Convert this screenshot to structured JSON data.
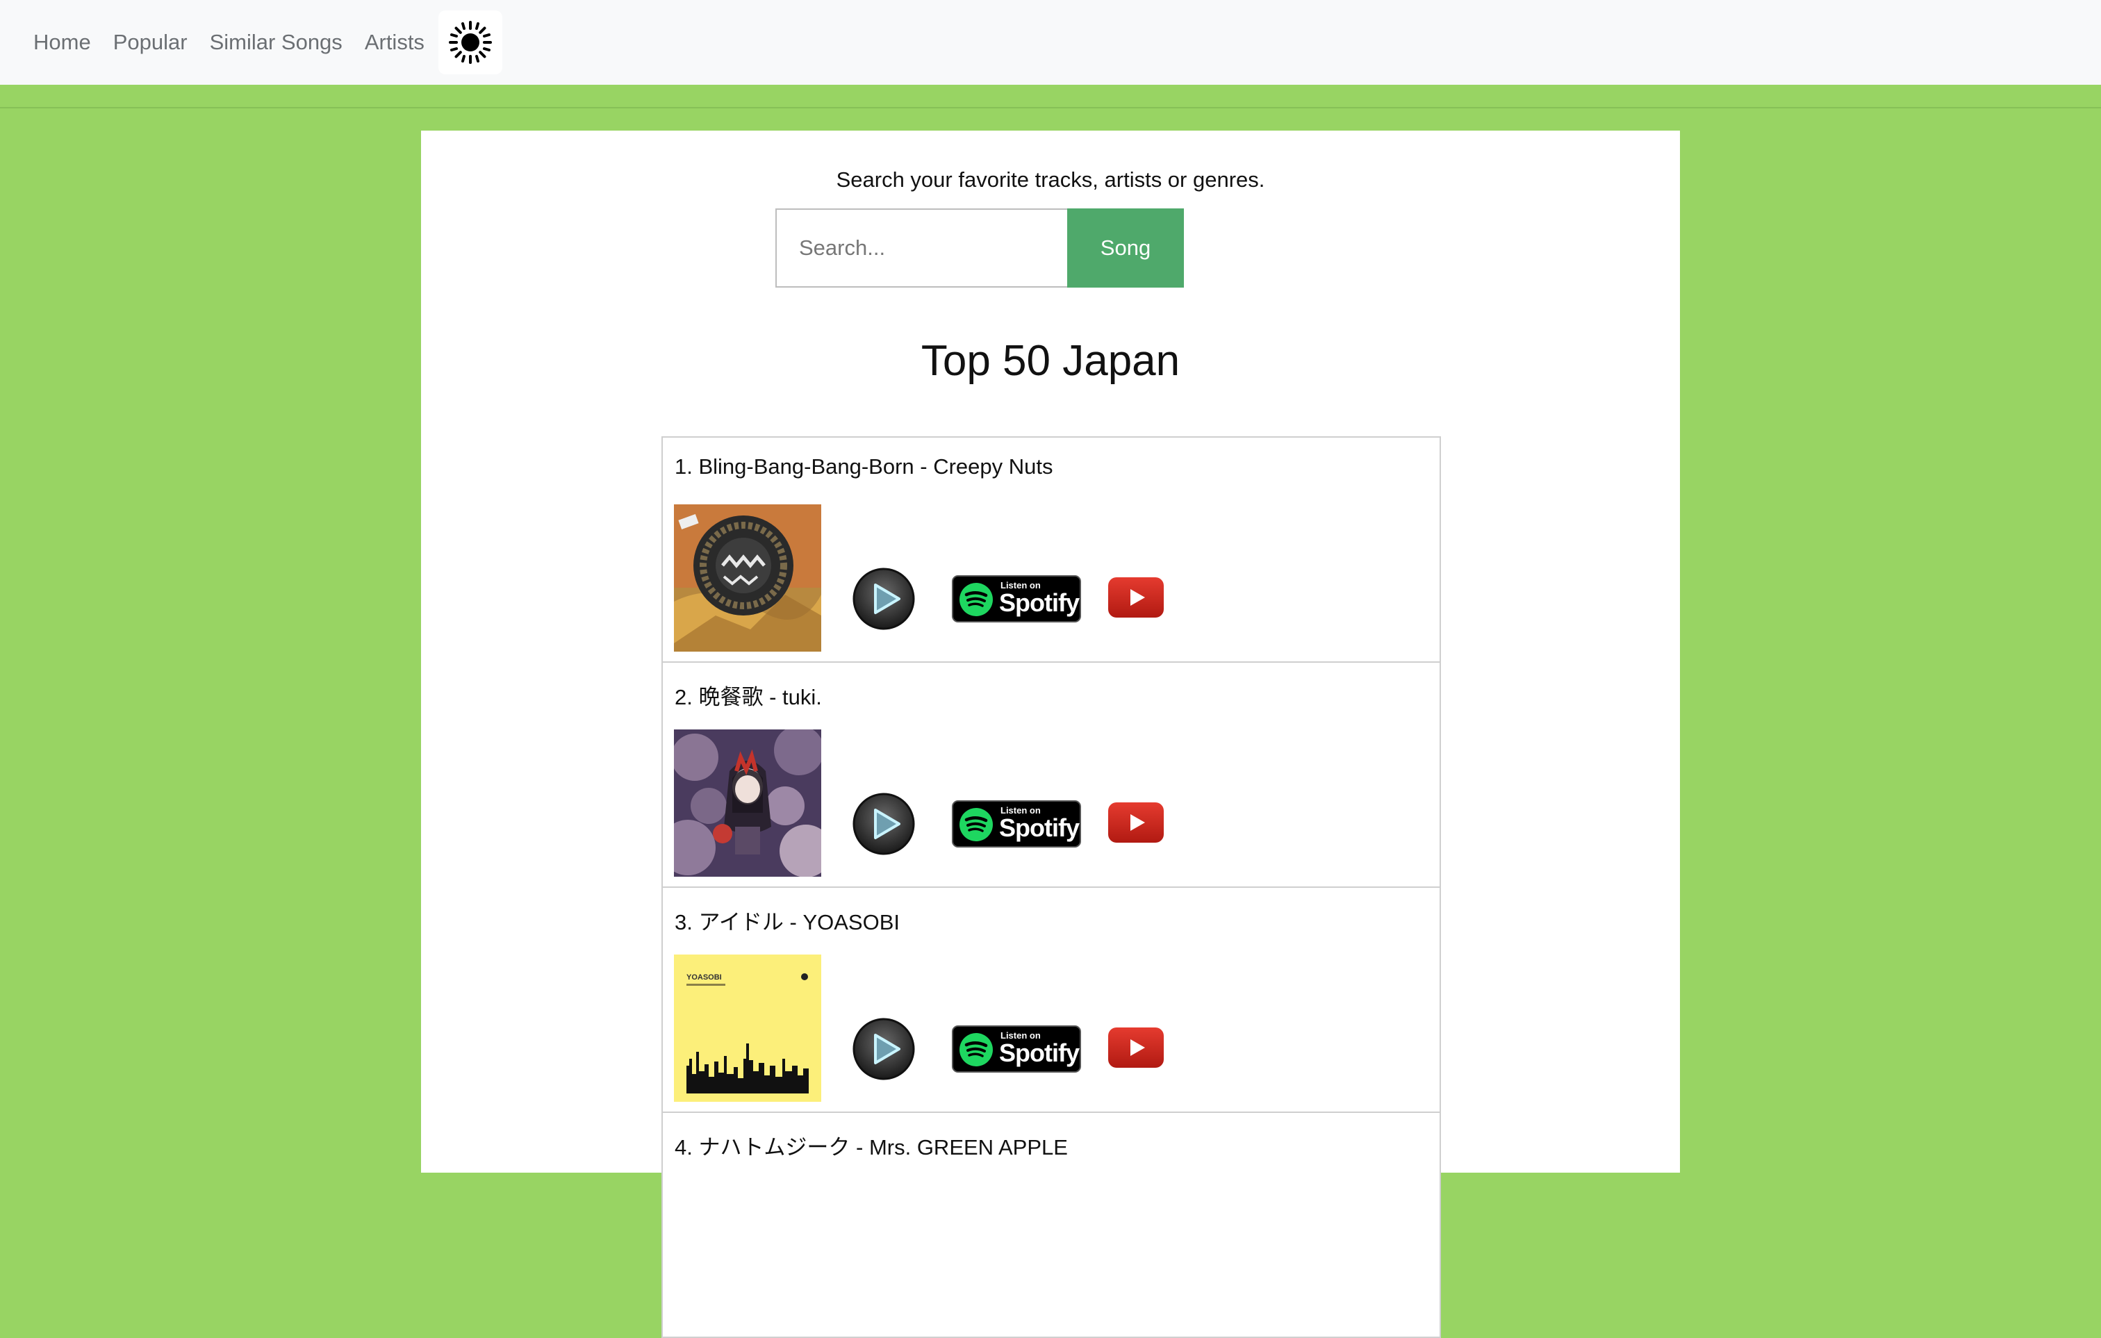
{
  "nav": {
    "items": [
      {
        "label": "Home"
      },
      {
        "label": "Popular"
      },
      {
        "label": "Similar Songs"
      },
      {
        "label": "Artists"
      }
    ],
    "theme_icon": "sun-icon"
  },
  "search": {
    "hint": "Search your favorite tracks, artists or genres.",
    "placeholder": "Search...",
    "value": "",
    "button_label": "Song"
  },
  "page": {
    "title": "Top 50 Japan"
  },
  "tracks": [
    {
      "label": "1. Bling-Bang-Bang-Born - Creepy Nuts"
    },
    {
      "label": "2. 晩餐歌 - tuki."
    },
    {
      "label": "3. アイドル - YOASOBI"
    },
    {
      "label": "4. ナハトムジーク - Mrs. GREEN APPLE"
    }
  ],
  "spotify": {
    "small": "Listen on",
    "big": "Spotify"
  },
  "album3": {
    "tag": "YOASOBI"
  },
  "colors": {
    "background": "#98d463",
    "navbar": "#f8f9fa",
    "song_button": "#4fa96b",
    "spotify_green": "#1ed760",
    "youtube_red": "#e0241b"
  },
  "icons": [
    "sun-icon",
    "play-icon",
    "spotify-icon",
    "youtube-icon"
  ]
}
